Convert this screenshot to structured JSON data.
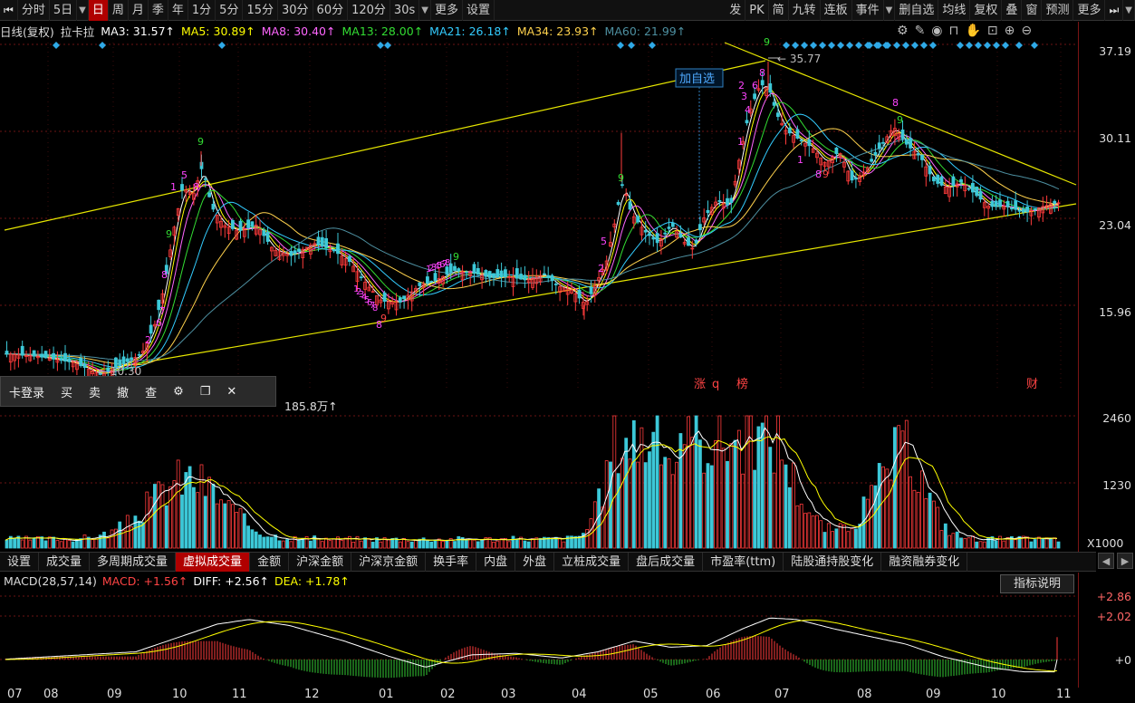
{
  "toolbar": {
    "items": [
      {
        "label": "⏮",
        "icon": "skip-start-icon"
      },
      {
        "label": "分时"
      },
      {
        "label": "5日"
      },
      {
        "label": "▼",
        "dd": true
      },
      {
        "label": "日",
        "active": true
      },
      {
        "label": "周"
      },
      {
        "label": "月"
      },
      {
        "label": "季"
      },
      {
        "label": "年"
      },
      {
        "label": "1分"
      },
      {
        "label": "5分"
      },
      {
        "label": "15分"
      },
      {
        "label": "30分"
      },
      {
        "label": "60分"
      },
      {
        "label": "120分"
      },
      {
        "label": "30s"
      },
      {
        "label": "▼",
        "dd": true
      },
      {
        "label": "更多"
      },
      {
        "label": "设置"
      }
    ],
    "right_items": [
      {
        "label": "发"
      },
      {
        "label": "PK"
      },
      {
        "label": "简"
      },
      {
        "label": "九转"
      },
      {
        "label": "连板"
      },
      {
        "label": "事件"
      },
      {
        "label": "▼",
        "dd": true
      },
      {
        "label": "删自选"
      },
      {
        "label": "均线"
      },
      {
        "label": "复权"
      },
      {
        "label": "叠"
      },
      {
        "label": "窗"
      },
      {
        "label": "预测"
      },
      {
        "label": "更多"
      },
      {
        "label": "⏭",
        "icon": "skip-end-icon"
      },
      {
        "label": "▼",
        "dd": true
      }
    ]
  },
  "ma_line": [
    {
      "text": "日线(复权)",
      "color": "#dddddd"
    },
    {
      "text": "拉卡拉",
      "color": "#dddddd"
    },
    {
      "text": "MA3: 31.57↑",
      "color": "#ffffff"
    },
    {
      "text": "MA5: 30.89↑",
      "color": "#ffff00"
    },
    {
      "text": "MA8: 30.40↑",
      "color": "#ff66ff"
    },
    {
      "text": "MA13: 28.00↑",
      "color": "#33dd33"
    },
    {
      "text": "MA21: 26.18↑",
      "color": "#33ccff"
    },
    {
      "text": "MA34: 23.93↑",
      "color": "#ffd24d"
    },
    {
      "text": "MA60: 21.99↑",
      "color": "#4d8fa0"
    }
  ],
  "top_icons": [
    "gear-icon",
    "pen-icon",
    "eye-icon",
    "basket-icon",
    "hand-icon",
    "lock-icon",
    "plus-icon",
    "minus-icon"
  ],
  "price_axis": [
    "37.19",
    "30.11",
    "23.04",
    "15.96"
  ],
  "annotations": {
    "high": "35.77",
    "low": "10.30",
    "add_fav": "加自选",
    "zhang": "涨",
    "q": "q",
    "bang": "榜",
    "cai": "财"
  },
  "trade_bar": [
    {
      "label": "卡登录",
      "name": "login-button"
    },
    {
      "label": "买",
      "name": "buy-button"
    },
    {
      "label": "卖",
      "name": "sell-button"
    },
    {
      "label": "撤",
      "name": "cancel-order-button"
    },
    {
      "label": "查",
      "name": "query-button"
    },
    {
      "label": "⚙",
      "name": "settings-icon"
    },
    {
      "label": "❐",
      "name": "restore-window-icon"
    },
    {
      "label": "✕",
      "name": "close-icon"
    }
  ],
  "volume": {
    "header_visible": "185.8万↑",
    "axis": [
      "2460",
      "1230"
    ],
    "unit": "X1000"
  },
  "tabs": [
    {
      "label": "设置"
    },
    {
      "label": "成交量"
    },
    {
      "label": "多周期成交量"
    },
    {
      "label": "虚拟成交量",
      "active": true
    },
    {
      "label": "金额"
    },
    {
      "label": "沪深金额"
    },
    {
      "label": "沪深京金额"
    },
    {
      "label": "换手率"
    },
    {
      "label": "内盘"
    },
    {
      "label": "外盘"
    },
    {
      "label": "立桩成交量"
    },
    {
      "label": "盘后成交量"
    },
    {
      "label": "市盈率(ttm)"
    },
    {
      "label": "陆股通持股变化"
    },
    {
      "label": "融资融券变化"
    }
  ],
  "tab_arrows": [
    "◀",
    "▶"
  ],
  "macd": {
    "items": [
      {
        "text": "MACD(28,57,14)",
        "color": "#dddddd"
      },
      {
        "text": "MACD: +1.56↑",
        "color": "#ff4444"
      },
      {
        "text": "DIFF: +2.56↑",
        "color": "#ffffff"
      },
      {
        "text": "DEA: +1.78↑",
        "color": "#ffff00"
      }
    ],
    "help": "指标说明",
    "axis": [
      "+2.86",
      "+2.02",
      "+0"
    ]
  },
  "dates": [
    "07",
    "08",
    "09",
    "10",
    "11",
    "12",
    "01",
    "02",
    "03",
    "04",
    "05",
    "06",
    "07",
    "08",
    "09",
    "10",
    "11"
  ],
  "colors": {
    "up": "#ff3b3b",
    "down": "#3cc8d8",
    "grid": "#6b1515",
    "trend": "#e6e600"
  }
}
